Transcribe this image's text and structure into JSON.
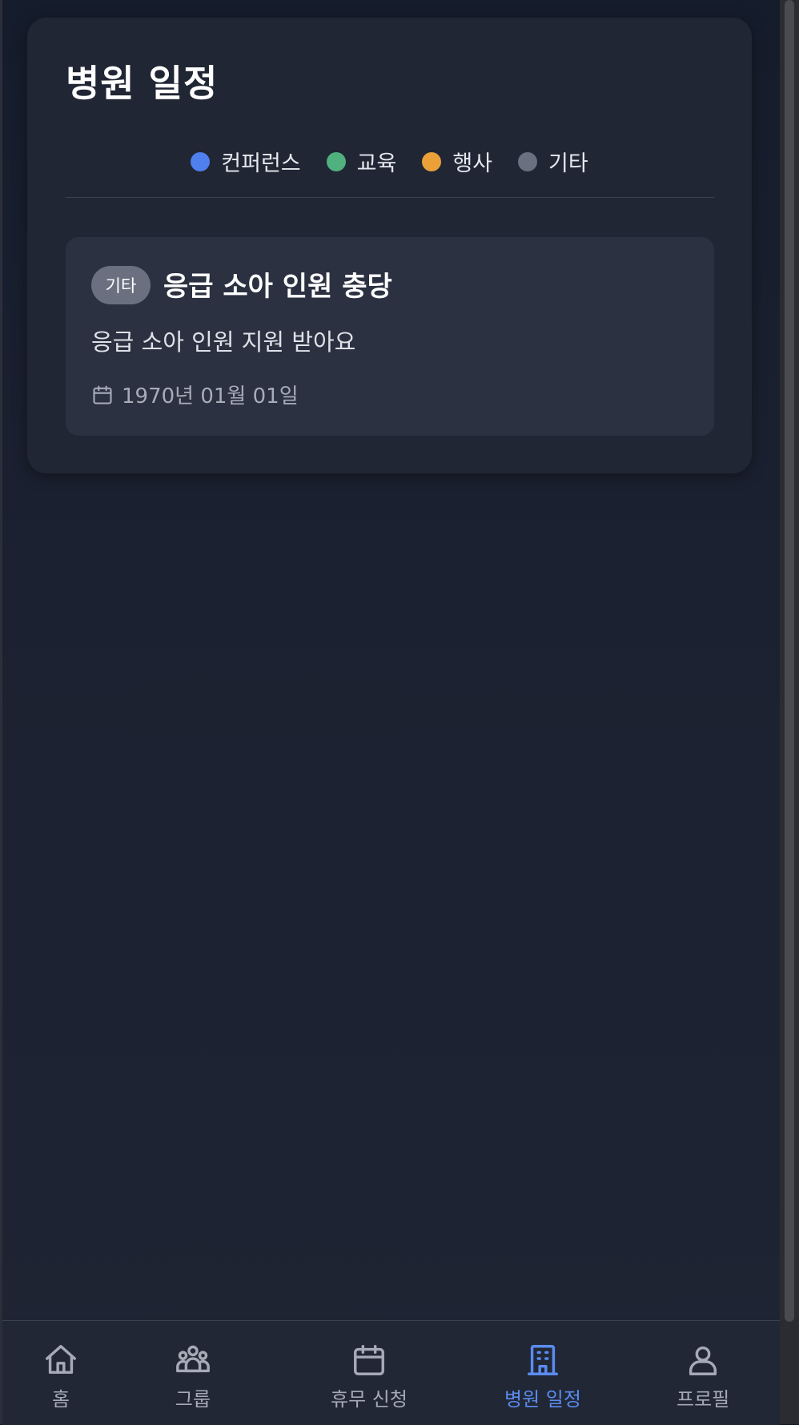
{
  "page": {
    "title": "병원 일정"
  },
  "legend": [
    {
      "label": "컨퍼런스",
      "color": "#5080ee"
    },
    {
      "label": "교육",
      "color": "#50b07e"
    },
    {
      "label": "행사",
      "color": "#eba03a"
    },
    {
      "label": "기타",
      "color": "#6b7080"
    }
  ],
  "events": [
    {
      "badge": "기타",
      "title": "응급 소아 인원 충당",
      "description": "응급 소아 인원 지원 받아요",
      "date": "1970년 01월 01일"
    }
  ],
  "nav": {
    "items": [
      {
        "label": "홈",
        "icon": "home-icon",
        "active": false
      },
      {
        "label": "그룹",
        "icon": "group-icon",
        "active": false
      },
      {
        "label": "휴무 신청",
        "icon": "calendar-icon",
        "active": false
      },
      {
        "label": "병원 일정",
        "icon": "hospital-building-icon",
        "active": true
      },
      {
        "label": "프로필",
        "icon": "user-icon",
        "active": false
      }
    ]
  },
  "colors": {
    "accent": "#5a8cf0",
    "background": "#1b2130",
    "card": "#202634"
  }
}
